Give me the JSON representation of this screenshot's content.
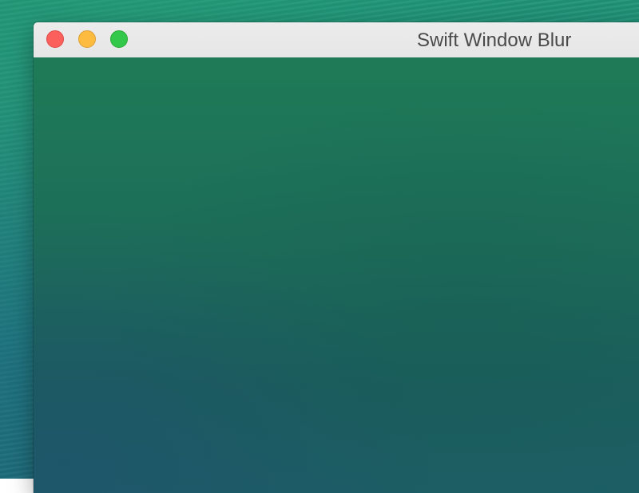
{
  "window": {
    "title": "Swift Window Blur"
  },
  "titlebar": {
    "buttons": [
      {
        "name": "close",
        "icon": "close-icon",
        "color": "#fc605c"
      },
      {
        "name": "minimize",
        "icon": "minimize-icon",
        "color": "#fdbc40"
      },
      {
        "name": "zoom",
        "icon": "zoom-icon",
        "color": "#34c84a"
      }
    ]
  },
  "colors": {
    "content_blur_tint": "#1e7b57",
    "titlebar_background": "#ececec",
    "title_text": "#4a4a4a"
  }
}
